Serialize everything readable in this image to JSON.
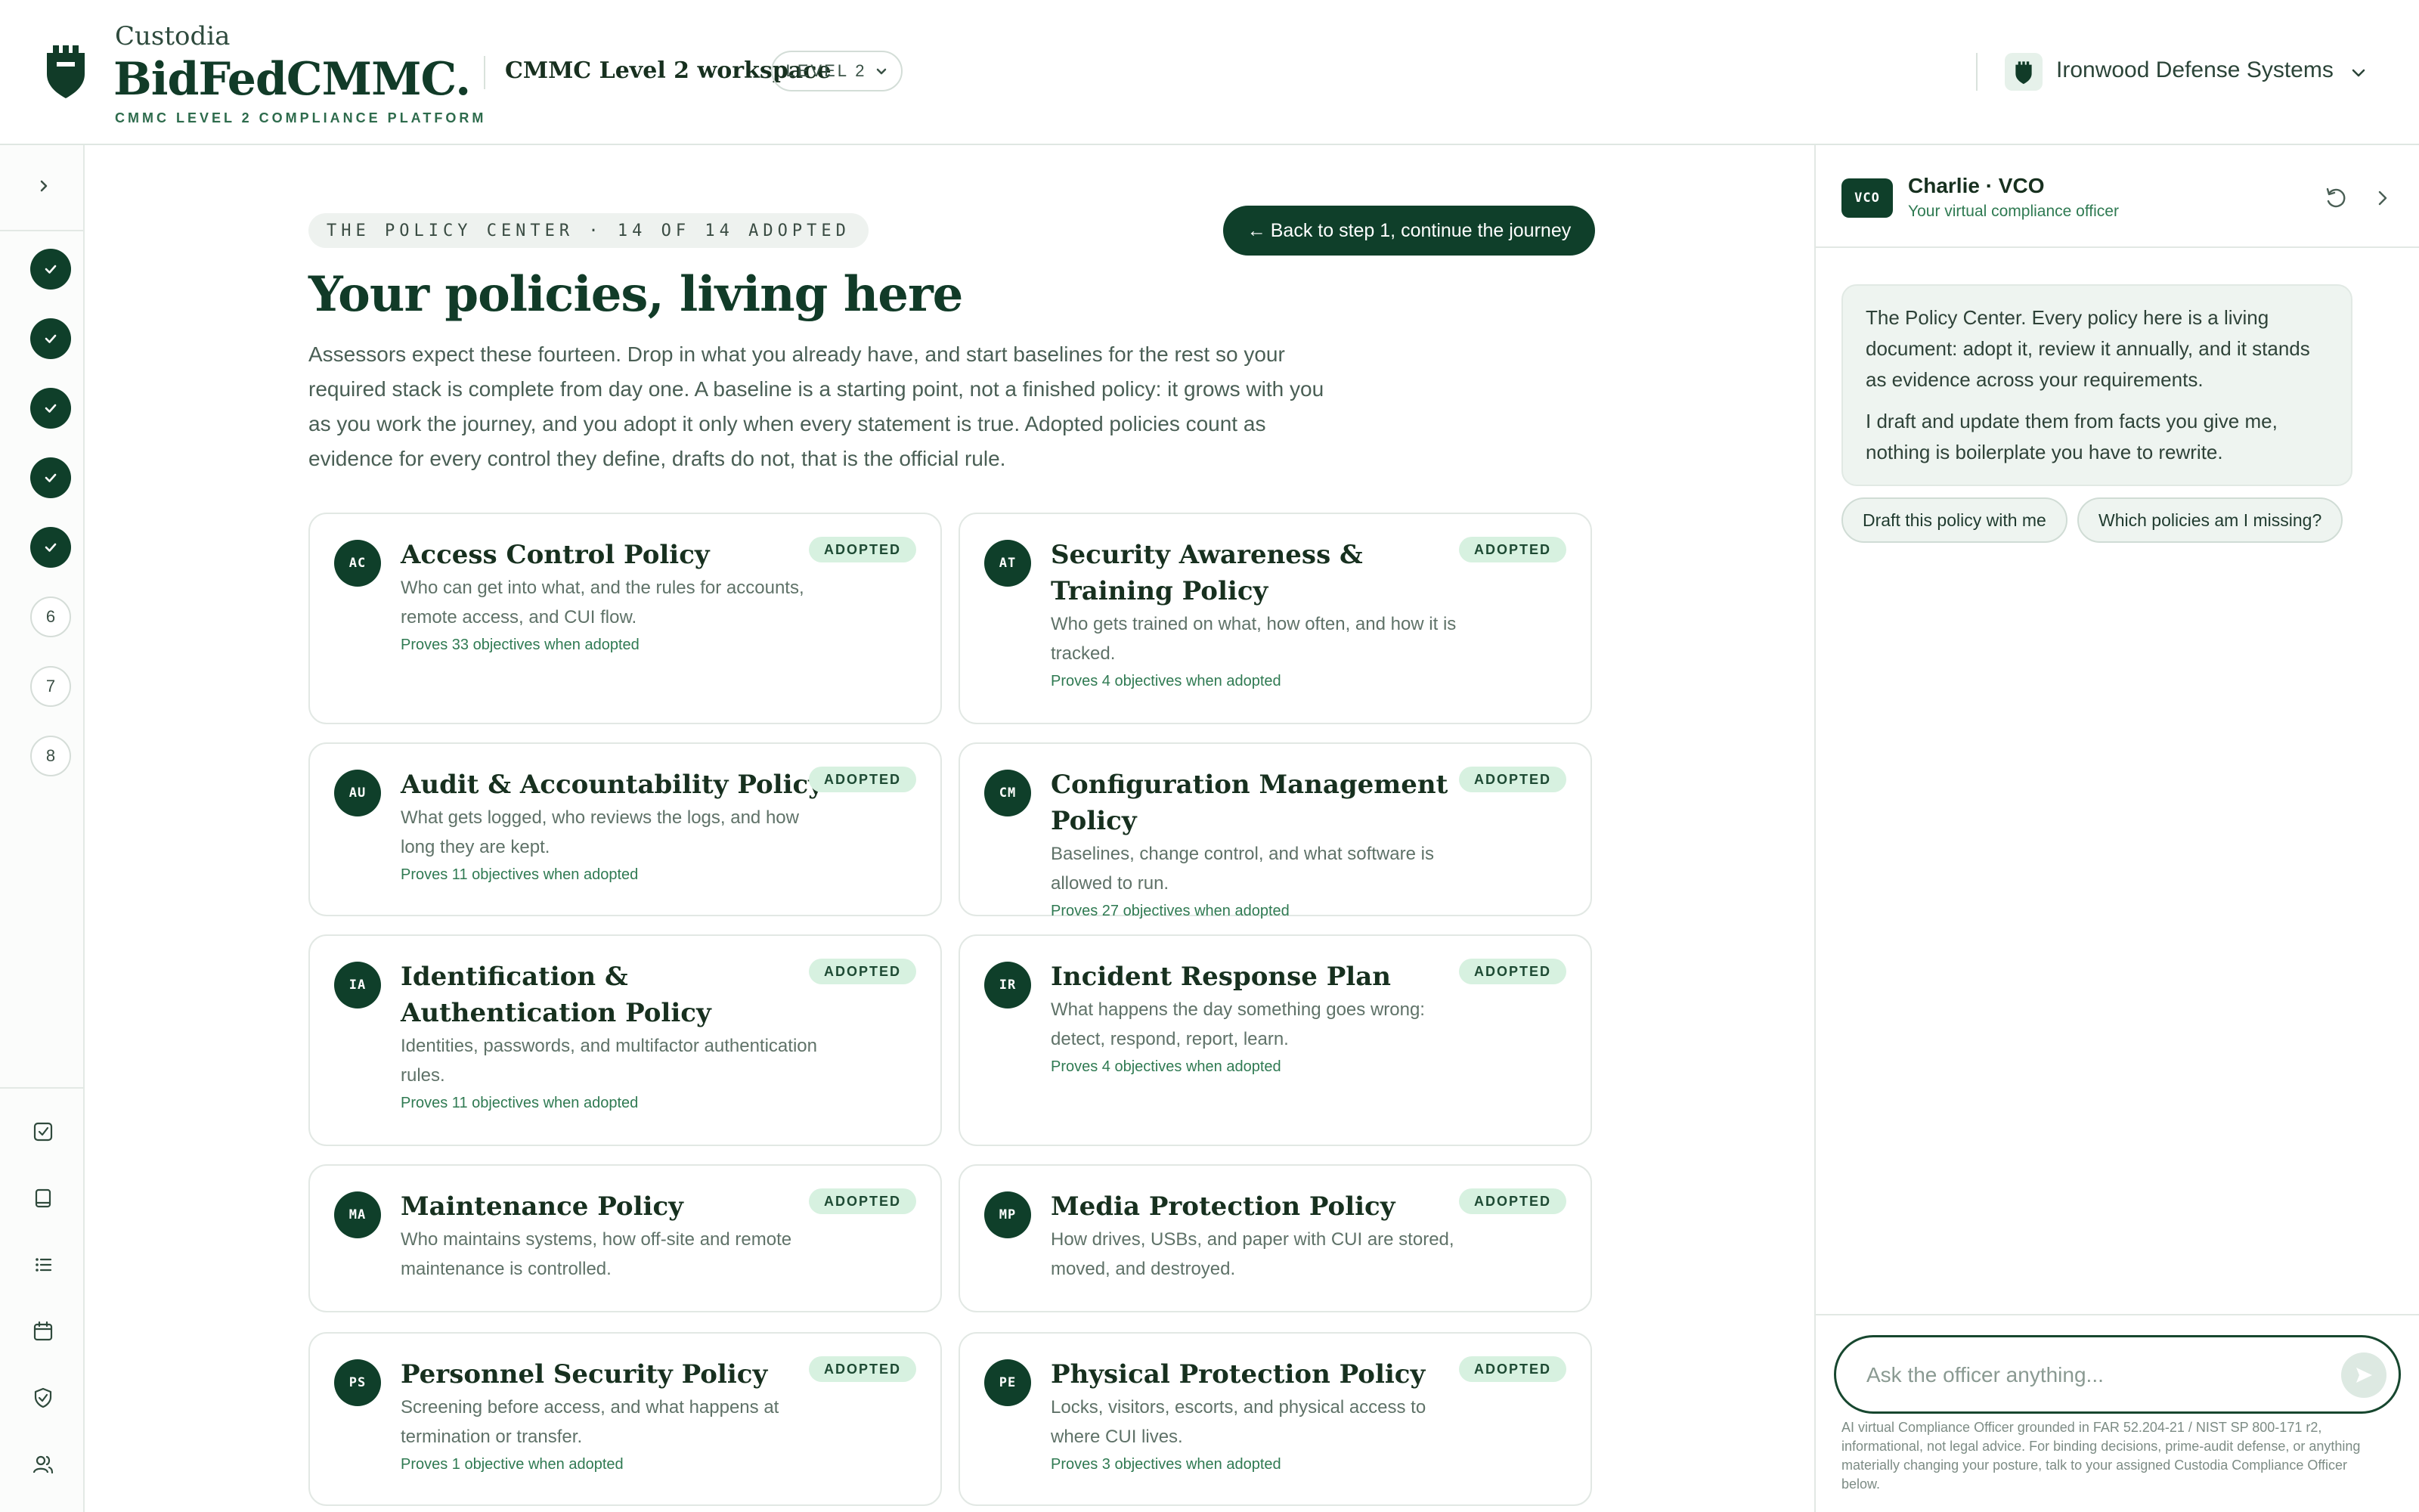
{
  "brand": {
    "company": "Custodia",
    "product": "BidFedCMMC.",
    "tagline": "CMMC LEVEL 2 COMPLIANCE PLATFORM"
  },
  "header": {
    "workspace_title": "CMMC Level 2 workspace",
    "level_label": "LEVEL 2",
    "org_name": "Ironwood Defense Systems"
  },
  "rail": {
    "steps": [
      {
        "label": "",
        "state": "done"
      },
      {
        "label": "",
        "state": "done"
      },
      {
        "label": "",
        "state": "done"
      },
      {
        "label": "",
        "state": "done"
      },
      {
        "label": "",
        "state": "done"
      },
      {
        "label": "6",
        "state": "todo"
      },
      {
        "label": "7",
        "state": "todo"
      },
      {
        "label": "8",
        "state": "todo"
      }
    ],
    "tools": [
      "checklist-icon",
      "book-icon",
      "list-icon",
      "calendar-icon",
      "shield-check-icon",
      "users-icon"
    ]
  },
  "main": {
    "eyebrow": "THE POLICY CENTER · 14 OF 14 ADOPTED",
    "back_button": "Back to step 1, continue the journey",
    "title": "Your policies, living here",
    "intro": "Assessors expect these fourteen. Drop in what you already have, and start baselines for the rest so your required stack is complete from day one. A baseline is a starting point, not a finished policy: it grows with you as you work the journey, and you adopt it only when every statement is true. Adopted policies count as evidence for every control they define, drafts do not, that is the official rule."
  },
  "policies": [
    {
      "code": "AC",
      "title": "Access Control Policy",
      "desc": "Who can get into what, and the rules for accounts, remote access, and CUI flow.",
      "proves": "Proves 33 objectives when adopted",
      "status": "ADOPTED"
    },
    {
      "code": "AT",
      "title": "Security Awareness & Training Policy",
      "desc": "Who gets trained on what, how often, and how it is tracked.",
      "proves": "Proves 4 objectives when adopted",
      "status": "ADOPTED"
    },
    {
      "code": "AU",
      "title": "Audit & Accountability Policy",
      "desc": "What gets logged, who reviews the logs, and how long they are kept.",
      "proves": "Proves 11 objectives when adopted",
      "status": "ADOPTED"
    },
    {
      "code": "CM",
      "title": "Configuration Management Policy",
      "desc": "Baselines, change control, and what software is allowed to run.",
      "proves": "Proves 27 objectives when adopted",
      "status": "ADOPTED"
    },
    {
      "code": "IA",
      "title": "Identification & Authentication Policy",
      "desc": "Identities, passwords, and multifactor authentication rules.",
      "proves": "Proves 11 objectives when adopted",
      "status": "ADOPTED"
    },
    {
      "code": "IR",
      "title": "Incident Response Plan",
      "desc": "What happens the day something goes wrong: detect, respond, report, learn.",
      "proves": "Proves 4 objectives when adopted",
      "status": "ADOPTED"
    },
    {
      "code": "MA",
      "title": "Maintenance Policy",
      "desc": "Who maintains systems, how off-site and remote maintenance is controlled.",
      "proves": "",
      "status": "ADOPTED"
    },
    {
      "code": "MP",
      "title": "Media Protection Policy",
      "desc": "How drives, USBs, and paper with CUI are stored, moved, and destroyed.",
      "proves": "",
      "status": "ADOPTED"
    },
    {
      "code": "PS",
      "title": "Personnel Security Policy",
      "desc": "Screening before access, and what happens at termination or transfer.",
      "proves": "Proves 1 objective when adopted",
      "status": "ADOPTED"
    },
    {
      "code": "PE",
      "title": "Physical Protection Policy",
      "desc": "Locks, visitors, escorts, and physical access to where CUI lives.",
      "proves": "Proves 3 objectives when adopted",
      "status": "ADOPTED"
    }
  ],
  "officer": {
    "badge": "VCO",
    "name": "Charlie · VCO",
    "role": "Your virtual compliance officer",
    "message_p1": "The Policy Center. Every policy here is a living document: adopt it, review it annually, and it stands as evidence across your requirements.",
    "message_p2": "I draft and update them from facts you give me, nothing is boilerplate you have to rewrite.",
    "chip1": "Draft this policy with me",
    "chip2": "Which policies am I missing?",
    "ask_placeholder": "Ask the officer anything...",
    "disclaimer": "AI virtual Compliance Officer grounded in FAR 52.204-21 / NIST SP 800-171 r2, informational, not legal advice. For binding decisions, prime-audit defense, or anything materially changing your posture, talk to your assigned Custodia Compliance Officer below."
  }
}
